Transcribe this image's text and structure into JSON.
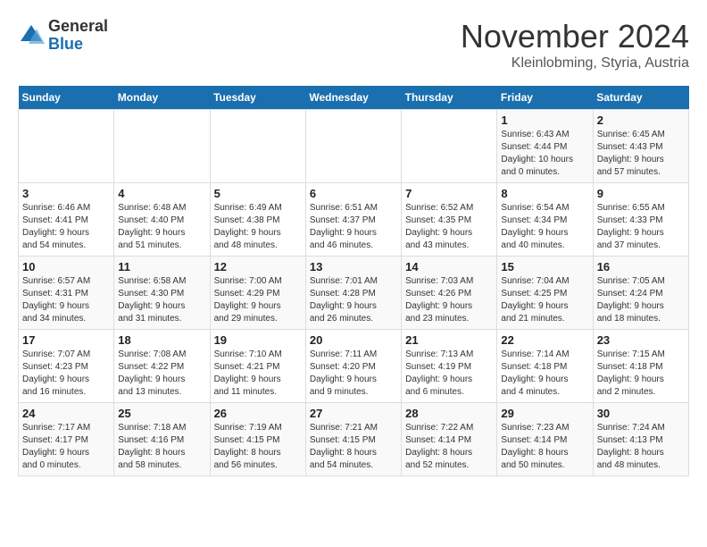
{
  "logo": {
    "general": "General",
    "blue": "Blue"
  },
  "header": {
    "month": "November 2024",
    "location": "Kleinlobming, Styria, Austria"
  },
  "weekdays": [
    "Sunday",
    "Monday",
    "Tuesday",
    "Wednesday",
    "Thursday",
    "Friday",
    "Saturday"
  ],
  "weeks": [
    [
      {
        "day": "",
        "info": ""
      },
      {
        "day": "",
        "info": ""
      },
      {
        "day": "",
        "info": ""
      },
      {
        "day": "",
        "info": ""
      },
      {
        "day": "",
        "info": ""
      },
      {
        "day": "1",
        "info": "Sunrise: 6:43 AM\nSunset: 4:44 PM\nDaylight: 10 hours\nand 0 minutes."
      },
      {
        "day": "2",
        "info": "Sunrise: 6:45 AM\nSunset: 4:43 PM\nDaylight: 9 hours\nand 57 minutes."
      }
    ],
    [
      {
        "day": "3",
        "info": "Sunrise: 6:46 AM\nSunset: 4:41 PM\nDaylight: 9 hours\nand 54 minutes."
      },
      {
        "day": "4",
        "info": "Sunrise: 6:48 AM\nSunset: 4:40 PM\nDaylight: 9 hours\nand 51 minutes."
      },
      {
        "day": "5",
        "info": "Sunrise: 6:49 AM\nSunset: 4:38 PM\nDaylight: 9 hours\nand 48 minutes."
      },
      {
        "day": "6",
        "info": "Sunrise: 6:51 AM\nSunset: 4:37 PM\nDaylight: 9 hours\nand 46 minutes."
      },
      {
        "day": "7",
        "info": "Sunrise: 6:52 AM\nSunset: 4:35 PM\nDaylight: 9 hours\nand 43 minutes."
      },
      {
        "day": "8",
        "info": "Sunrise: 6:54 AM\nSunset: 4:34 PM\nDaylight: 9 hours\nand 40 minutes."
      },
      {
        "day": "9",
        "info": "Sunrise: 6:55 AM\nSunset: 4:33 PM\nDaylight: 9 hours\nand 37 minutes."
      }
    ],
    [
      {
        "day": "10",
        "info": "Sunrise: 6:57 AM\nSunset: 4:31 PM\nDaylight: 9 hours\nand 34 minutes."
      },
      {
        "day": "11",
        "info": "Sunrise: 6:58 AM\nSunset: 4:30 PM\nDaylight: 9 hours\nand 31 minutes."
      },
      {
        "day": "12",
        "info": "Sunrise: 7:00 AM\nSunset: 4:29 PM\nDaylight: 9 hours\nand 29 minutes."
      },
      {
        "day": "13",
        "info": "Sunrise: 7:01 AM\nSunset: 4:28 PM\nDaylight: 9 hours\nand 26 minutes."
      },
      {
        "day": "14",
        "info": "Sunrise: 7:03 AM\nSunset: 4:26 PM\nDaylight: 9 hours\nand 23 minutes."
      },
      {
        "day": "15",
        "info": "Sunrise: 7:04 AM\nSunset: 4:25 PM\nDaylight: 9 hours\nand 21 minutes."
      },
      {
        "day": "16",
        "info": "Sunrise: 7:05 AM\nSunset: 4:24 PM\nDaylight: 9 hours\nand 18 minutes."
      }
    ],
    [
      {
        "day": "17",
        "info": "Sunrise: 7:07 AM\nSunset: 4:23 PM\nDaylight: 9 hours\nand 16 minutes."
      },
      {
        "day": "18",
        "info": "Sunrise: 7:08 AM\nSunset: 4:22 PM\nDaylight: 9 hours\nand 13 minutes."
      },
      {
        "day": "19",
        "info": "Sunrise: 7:10 AM\nSunset: 4:21 PM\nDaylight: 9 hours\nand 11 minutes."
      },
      {
        "day": "20",
        "info": "Sunrise: 7:11 AM\nSunset: 4:20 PM\nDaylight: 9 hours\nand 9 minutes."
      },
      {
        "day": "21",
        "info": "Sunrise: 7:13 AM\nSunset: 4:19 PM\nDaylight: 9 hours\nand 6 minutes."
      },
      {
        "day": "22",
        "info": "Sunrise: 7:14 AM\nSunset: 4:18 PM\nDaylight: 9 hours\nand 4 minutes."
      },
      {
        "day": "23",
        "info": "Sunrise: 7:15 AM\nSunset: 4:18 PM\nDaylight: 9 hours\nand 2 minutes."
      }
    ],
    [
      {
        "day": "24",
        "info": "Sunrise: 7:17 AM\nSunset: 4:17 PM\nDaylight: 9 hours\nand 0 minutes."
      },
      {
        "day": "25",
        "info": "Sunrise: 7:18 AM\nSunset: 4:16 PM\nDaylight: 8 hours\nand 58 minutes."
      },
      {
        "day": "26",
        "info": "Sunrise: 7:19 AM\nSunset: 4:15 PM\nDaylight: 8 hours\nand 56 minutes."
      },
      {
        "day": "27",
        "info": "Sunrise: 7:21 AM\nSunset: 4:15 PM\nDaylight: 8 hours\nand 54 minutes."
      },
      {
        "day": "28",
        "info": "Sunrise: 7:22 AM\nSunset: 4:14 PM\nDaylight: 8 hours\nand 52 minutes."
      },
      {
        "day": "29",
        "info": "Sunrise: 7:23 AM\nSunset: 4:14 PM\nDaylight: 8 hours\nand 50 minutes."
      },
      {
        "day": "30",
        "info": "Sunrise: 7:24 AM\nSunset: 4:13 PM\nDaylight: 8 hours\nand 48 minutes."
      }
    ]
  ]
}
